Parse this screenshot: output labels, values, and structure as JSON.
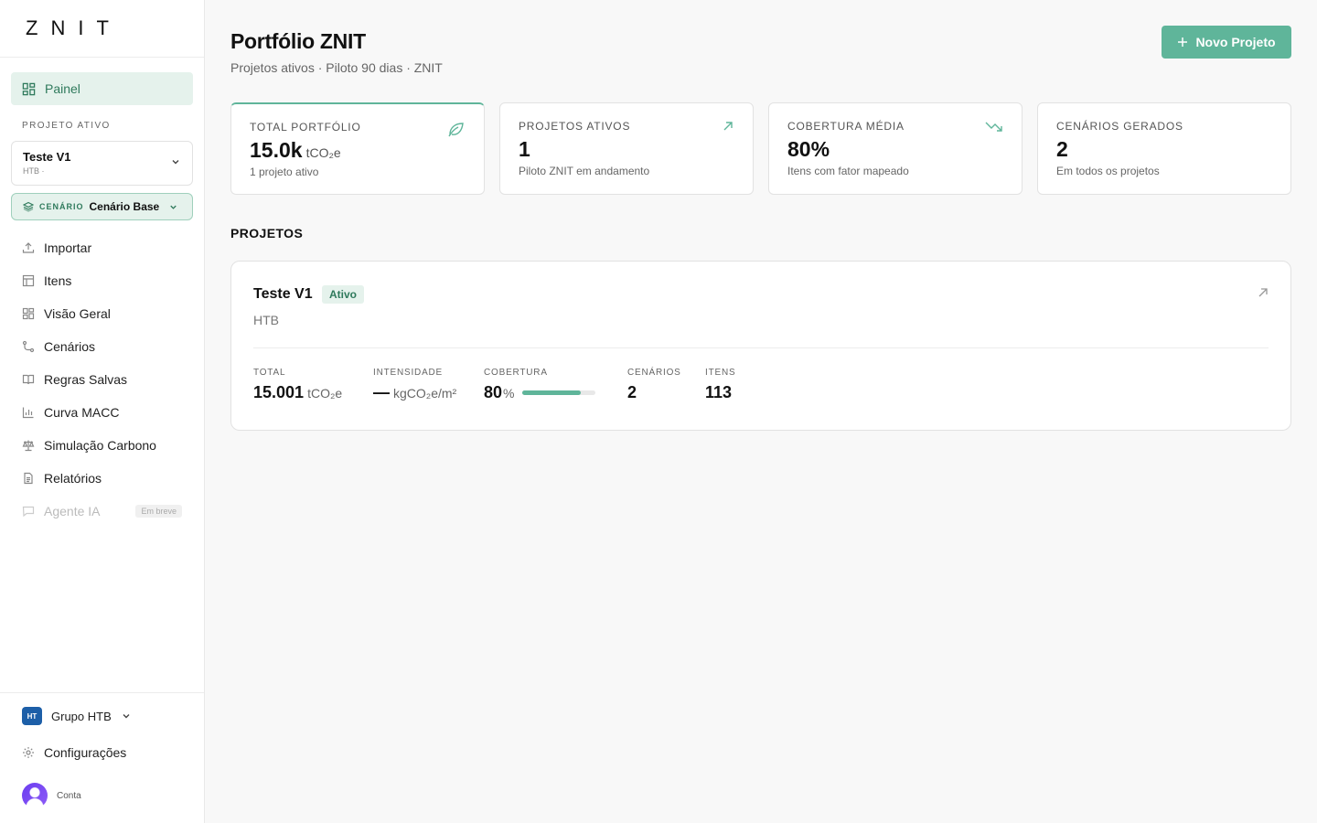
{
  "brand": {
    "logo_text": "ZNIT"
  },
  "sidebar": {
    "painel_label": "Painel",
    "active_project_label": "PROJETO ATIVO",
    "project": {
      "name": "Teste V1",
      "sub": "HTB ·"
    },
    "scenario": {
      "label": "CENÁRIO",
      "value": "Cenário Base"
    },
    "items": [
      {
        "label": "Importar",
        "icon": "upload-icon"
      },
      {
        "label": "Itens",
        "icon": "table-icon"
      },
      {
        "label": "Visão Geral",
        "icon": "grid-icon"
      },
      {
        "label": "Cenários",
        "icon": "branch-icon"
      },
      {
        "label": "Regras Salvas",
        "icon": "book-icon"
      },
      {
        "label": "Curva MACC",
        "icon": "bar-chart-icon"
      },
      {
        "label": "Simulação Carbono",
        "icon": "scale-icon"
      },
      {
        "label": "Relatórios",
        "icon": "document-icon"
      },
      {
        "label": "Agente IA",
        "icon": "chat-icon",
        "badge": "Em breve",
        "disabled": true
      }
    ],
    "org": {
      "logo_text": "HT",
      "name": "Grupo HTB"
    },
    "settings_label": "Configurações",
    "account_label": "Conta"
  },
  "header": {
    "title": "Portfólio ZNIT",
    "subtitle": "Projetos ativos · Piloto 90 dias · ZNIT",
    "new_project_label": "Novo Projeto"
  },
  "kpis": [
    {
      "label": "TOTAL PORTFÓLIO",
      "value": "15.0k",
      "unit": "tCO₂e",
      "sub": "1 projeto ativo",
      "icon": "leaf-icon"
    },
    {
      "label": "PROJETOS ATIVOS",
      "value": "1",
      "unit": "",
      "sub": "Piloto ZNIT em andamento",
      "icon": "arrow-up-right-icon"
    },
    {
      "label": "COBERTURA MÉDIA",
      "value": "80%",
      "unit": "",
      "sub": "Itens com fator mapeado",
      "icon": "trending-down-icon"
    },
    {
      "label": "CENÁRIOS GERADOS",
      "value": "2",
      "unit": "",
      "sub": "Em todos os projetos"
    }
  ],
  "projects_section_title": "PROJETOS",
  "project_card": {
    "name": "Teste V1",
    "status": "Ativo",
    "org": "HTB",
    "metrics": {
      "total": {
        "label": "TOTAL",
        "value": "15.001",
        "unit": "tCO₂e"
      },
      "intensity": {
        "label": "INTENSIDADE",
        "value": "—",
        "unit": "kgCO₂e/m²"
      },
      "coverage": {
        "label": "COBERTURA",
        "value": "80",
        "unit": "%",
        "fraction": 0.8
      },
      "scenarios": {
        "label": "CENÁRIOS",
        "value": "2"
      },
      "items": {
        "label": "ITENS",
        "value": "113"
      }
    }
  },
  "colors": {
    "accent": "#5fb59a",
    "accent_dark": "#2f7a5c",
    "accent_bg": "#e5f2ec"
  }
}
